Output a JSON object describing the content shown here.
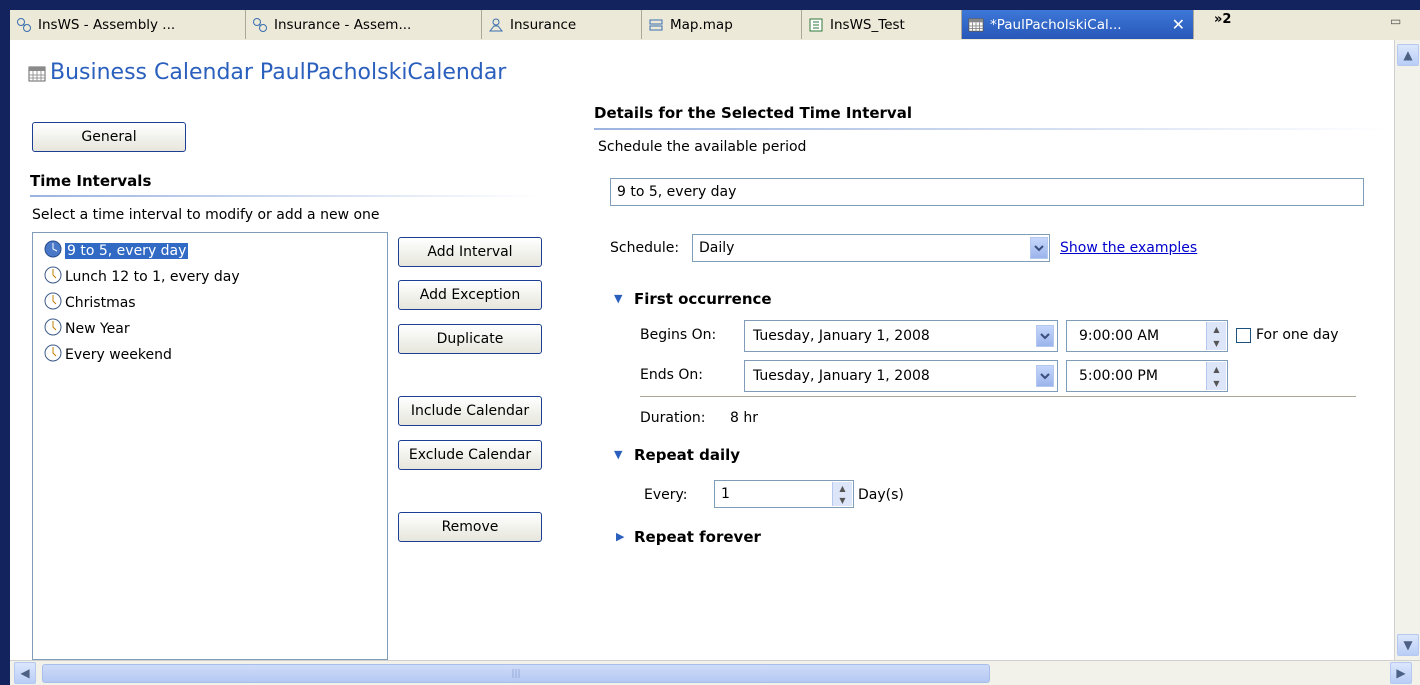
{
  "tabs": [
    {
      "label": "InsWS - Assembly ...",
      "icon": "assembly-icon"
    },
    {
      "label": "Insurance - Assem...",
      "icon": "assembly-icon"
    },
    {
      "label": "Insurance",
      "icon": "business-object-icon"
    },
    {
      "label": "Map.map",
      "icon": "map-icon"
    },
    {
      "label": "InsWS_Test",
      "icon": "test-icon"
    },
    {
      "label": "*PaulPacholskiCal...",
      "icon": "calendar-icon",
      "active": true
    }
  ],
  "tab_overflow": "»2",
  "title": "Business Calendar PaulPacholskiCalendar",
  "left": {
    "general_button": "General",
    "section_title": "Time Intervals",
    "instruction": "Select a time interval to modify or add a new one",
    "intervals": [
      {
        "label": "9 to 5, every day",
        "selected": true
      },
      {
        "label": "Lunch 12 to 1, every day",
        "selected": false
      },
      {
        "label": "Christmas",
        "selected": false
      },
      {
        "label": "New Year",
        "selected": false
      },
      {
        "label": "Every weekend",
        "selected": false
      }
    ],
    "buttons": {
      "add_interval": "Add Interval",
      "add_exception": "Add Exception",
      "duplicate": "Duplicate",
      "include_calendar": "Include Calendar",
      "exclude_calendar": "Exclude Calendar",
      "remove": "Remove"
    }
  },
  "right": {
    "section_title": "Details for the Selected Time Interval",
    "subtitle": "Schedule the available period",
    "name_value": "9 to 5, every day",
    "schedule_label": "Schedule:",
    "schedule_value": "Daily",
    "examples_link": "Show the examples",
    "first_occurrence": {
      "title": "First occurrence",
      "begins_label": "Begins On:",
      "begins_date": "Tuesday, January 1, 2008",
      "begins_time": "9:00:00 AM",
      "for_one_day": "For one day",
      "for_one_day_checked": false,
      "ends_label": "Ends On:",
      "ends_date": "Tuesday, January 1, 2008",
      "ends_time": "5:00:00 PM",
      "duration_label": "Duration:",
      "duration_value": "8 hr"
    },
    "repeat_daily": {
      "title": "Repeat daily",
      "every_label": "Every:",
      "every_value": "1",
      "unit": "Day(s)"
    },
    "repeat_forever": {
      "title": "Repeat forever"
    }
  },
  "colors": {
    "accent": "#2a5fbd",
    "selection": "#316ac5",
    "desktop": "#12235e",
    "link": "#0000cc"
  }
}
